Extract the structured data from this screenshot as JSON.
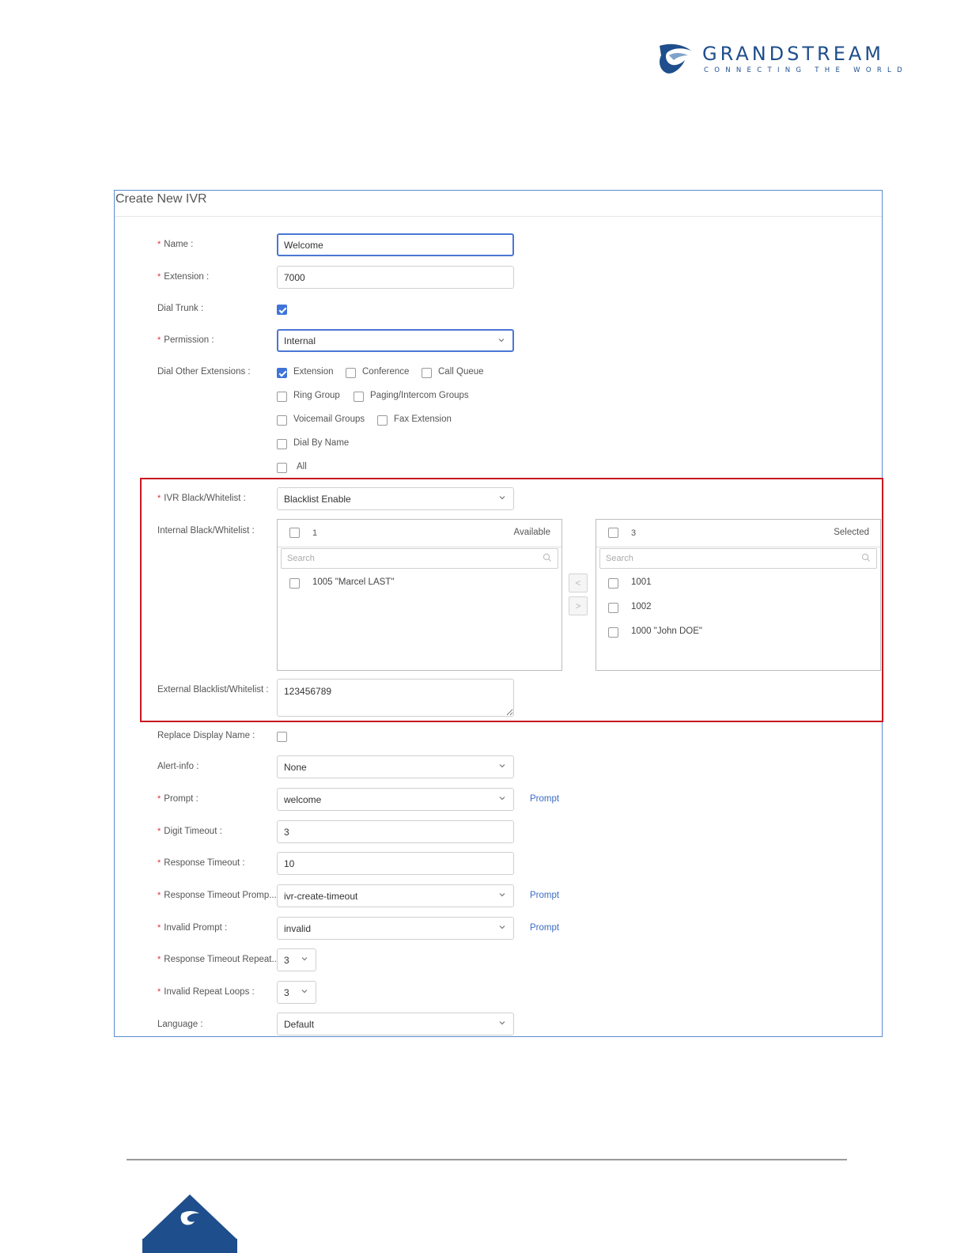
{
  "brand": {
    "name": "GRANDSTREAM",
    "tagline": "CONNECTING THE WORLD"
  },
  "form": {
    "title": "Create New IVR",
    "name": {
      "label": "Name :",
      "value": "Welcome"
    },
    "extension": {
      "label": "Extension :",
      "value": "7000"
    },
    "dial_trunk": {
      "label": "Dial Trunk :",
      "checked": true
    },
    "permission": {
      "label": "Permission :",
      "value": "Internal"
    },
    "dial_other": {
      "label": "Dial Other Extensions :",
      "options": [
        {
          "label": "Extension",
          "checked": true
        },
        {
          "label": "Conference",
          "checked": false
        },
        {
          "label": "Call Queue",
          "checked": false
        },
        {
          "label": "Ring Group",
          "checked": false
        },
        {
          "label": "Paging/Intercom Groups",
          "checked": false
        },
        {
          "label": "Voicemail Groups",
          "checked": false
        },
        {
          "label": "Fax Extension",
          "checked": false
        },
        {
          "label": "Dial By Name",
          "checked": false
        },
        {
          "label": "All",
          "checked": false
        }
      ]
    },
    "ivr_bw": {
      "label": "IVR Black/Whitelist :",
      "value": "Blacklist Enable"
    },
    "internal_bw": {
      "label": "Internal Black/Whitelist :",
      "available": {
        "count": "1",
        "title": "Available",
        "search_placeholder": "Search",
        "items": [
          "1005 \"Marcel LAST\""
        ]
      },
      "selected": {
        "count": "3",
        "title": "Selected",
        "search_placeholder": "Search",
        "items": [
          "1001",
          "1002",
          "1000 \"John DOE\""
        ]
      },
      "move_left": "<",
      "move_right": ">"
    },
    "external_bw": {
      "label": "External Blacklist/Whitelist :",
      "value": "123456789"
    },
    "replace_display_name": {
      "label": "Replace Display Name :",
      "checked": false
    },
    "alert_info": {
      "label": "Alert-info :",
      "value": "None"
    },
    "prompt": {
      "label": "Prompt :",
      "value": "welcome",
      "link": "Prompt"
    },
    "digit_timeout": {
      "label": "Digit Timeout :",
      "value": "3"
    },
    "response_timeout": {
      "label": "Response Timeout :",
      "value": "10"
    },
    "response_timeout_prompt": {
      "label": "Response Timeout Promp...",
      "value": "ivr-create-timeout",
      "link": "Prompt"
    },
    "invalid_prompt": {
      "label": "Invalid Prompt :",
      "value": "invalid",
      "link": "Prompt"
    },
    "response_timeout_repeat": {
      "label": "Response Timeout Repeat...",
      "value": "3"
    },
    "invalid_repeat_loops": {
      "label": "Invalid Repeat Loops :",
      "value": "3"
    },
    "language": {
      "label": "Language :",
      "value": "Default"
    },
    "required_mark": "*"
  },
  "colors": {
    "accent": "#3f74d9",
    "brand": "#1f4e8c",
    "highlight": "#c8181f",
    "required": "#e0322d"
  }
}
